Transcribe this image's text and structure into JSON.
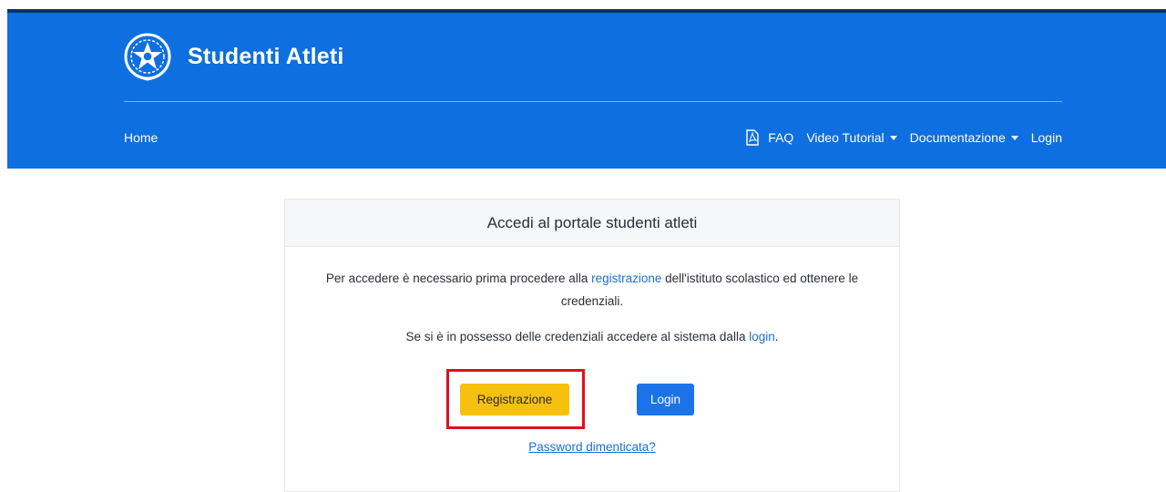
{
  "header": {
    "title": "Studenti Atleti",
    "emblem_icon": "italian-republic-emblem-icon",
    "nav": {
      "home": "Home",
      "faq": "FAQ",
      "video_tutorial": "Video Tutorial",
      "documentazione": "Documentazione",
      "login": "Login"
    }
  },
  "card": {
    "title": "Accedi al portale studenti atleti",
    "p1_before": "Per accedere è necessario prima procedere alla ",
    "p1_link": "registrazione",
    "p1_after": " dell'istituto scolastico ed ottenere le credenziali.",
    "p2_before": "Se si è in possesso delle credenziali accedere al sistema dalla ",
    "p2_link": "login",
    "p2_after": ".",
    "register_button": "Registrazione",
    "login_button": "Login",
    "forgot_password": "Password dimenticata?"
  },
  "colors": {
    "header_blue": "#0e6fe0",
    "register_yellow": "#f6c00e",
    "login_blue": "#1a73e8",
    "highlight_red": "#e0101c",
    "link_blue": "#1d6fd8"
  }
}
